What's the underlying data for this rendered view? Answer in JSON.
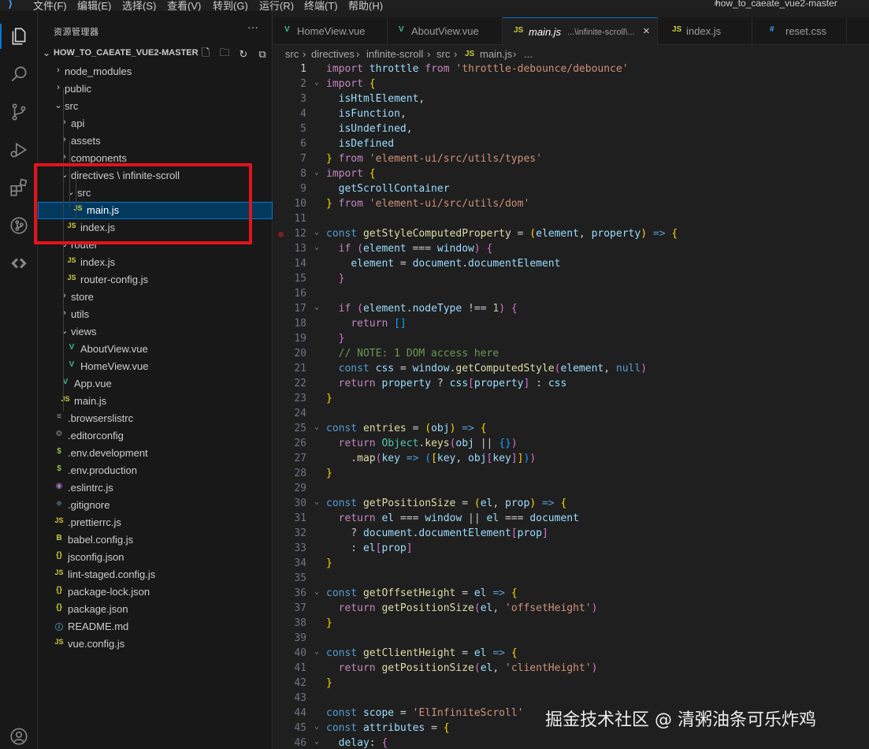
{
  "titlebar": {
    "menus": [
      "文件(F)",
      "编辑(E)",
      "选择(S)",
      "查看(V)",
      "转到(G)",
      "运行(R)",
      "终端(T)",
      "帮助(H)"
    ],
    "project": "how_to_caeate_vue2-master"
  },
  "sidebar": {
    "title": "资源管理器",
    "more": "···",
    "project_name": "HOW_TO_CAEATE_VUE2-MASTER",
    "tree": [
      {
        "label": "node_modules",
        "type": "folder"
      },
      {
        "label": "public",
        "type": "folder"
      },
      {
        "label": "src",
        "type": "folder-open"
      },
      {
        "label": "api",
        "type": "folder"
      },
      {
        "label": "assets",
        "type": "folder"
      },
      {
        "label": "components",
        "type": "folder"
      },
      {
        "label": "directives \\ infinite-scroll",
        "type": "folder-open"
      },
      {
        "label": "src",
        "type": "folder-open"
      },
      {
        "label": "main.js",
        "type": "js"
      },
      {
        "label": "index.js",
        "type": "js"
      },
      {
        "label": "router",
        "type": "folder-open"
      },
      {
        "label": "index.js",
        "type": "js"
      },
      {
        "label": "router-config.js",
        "type": "js"
      },
      {
        "label": "store",
        "type": "folder"
      },
      {
        "label": "utils",
        "type": "folder"
      },
      {
        "label": "views",
        "type": "folder-open"
      },
      {
        "label": "AboutView.vue",
        "type": "vue"
      },
      {
        "label": "HomeView.vue",
        "type": "vue"
      },
      {
        "label": "App.vue",
        "type": "vue"
      },
      {
        "label": "main.js",
        "type": "js"
      },
      {
        "label": ".browserslistrc",
        "type": "lines"
      },
      {
        "label": ".editorconfig",
        "type": "gear"
      },
      {
        "label": ".env.development",
        "type": "env"
      },
      {
        "label": ".env.production",
        "type": "env"
      },
      {
        "label": ".eslintrc.js",
        "type": "eslint"
      },
      {
        "label": ".gitignore",
        "type": "git"
      },
      {
        "label": ".prettierrc.js",
        "type": "js"
      },
      {
        "label": "babel.config.js",
        "type": "babel"
      },
      {
        "label": "jsconfig.json",
        "type": "json"
      },
      {
        "label": "lint-staged.config.js",
        "type": "js"
      },
      {
        "label": "package-lock.json",
        "type": "json"
      },
      {
        "label": "package.json",
        "type": "json"
      },
      {
        "label": "README.md",
        "type": "info"
      },
      {
        "label": "vue.config.js",
        "type": "js"
      }
    ]
  },
  "icons": {
    "js": "JS",
    "vue": "V",
    "json": "{}",
    "env": "$",
    "info": "ⓘ",
    "babel": "B",
    "gear": "⚙",
    "git": "◆",
    "eslint": "◉",
    "lines": "≡"
  },
  "tabs": [
    {
      "label": "HomeView.vue",
      "icon": "V"
    },
    {
      "label": "AboutView.vue",
      "icon": "V"
    },
    {
      "label": "main.js",
      "detail": "...\\infinite-scroll\\...",
      "icon": "JS",
      "close": "×"
    },
    {
      "label": "index.js",
      "icon": "JS"
    },
    {
      "label": "reset.css",
      "icon": "#"
    }
  ],
  "breadcrumb": [
    "src",
    "directives",
    "infinite-scroll",
    "src",
    "main.js",
    "..."
  ],
  "breadcrumb_sep": "›",
  "code_lines": [
    "1",
    "2",
    "3",
    "4",
    "5",
    "6",
    "7",
    "8",
    "9",
    "10",
    "11",
    "12",
    "13",
    "14",
    "15",
    "16",
    "17",
    "18",
    "19",
    "20",
    "21",
    "22",
    "23",
    "24",
    "25",
    "26",
    "27",
    "28",
    "29",
    "30",
    "31",
    "32",
    "33",
    "34",
    "35",
    "36",
    "37",
    "38",
    "39",
    "40",
    "41",
    "42",
    "43",
    "44",
    "45",
    "46"
  ],
  "watermark": "掘金技术社区 @ 清粥油条可乐炸鸡"
}
